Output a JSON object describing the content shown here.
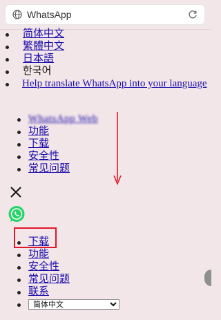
{
  "browser": {
    "url_text": "WhatsApp"
  },
  "languages": [
    {
      "label": "简体中文"
    },
    {
      "label": "繁體中文"
    },
    {
      "label": "日本語"
    },
    {
      "label": "한국어"
    },
    {
      "label": "Help translate WhatsApp into your language"
    }
  ],
  "nav_primary": {
    "items": [
      {
        "label": "WhatsApp Web"
      },
      {
        "label": "功能"
      },
      {
        "label": "下载"
      },
      {
        "label": "安全性"
      },
      {
        "label": "常见问题"
      }
    ]
  },
  "nav_secondary": {
    "items": [
      {
        "label": "下载"
      },
      {
        "label": "功能"
      },
      {
        "label": "安全性"
      },
      {
        "label": "常见问题"
      },
      {
        "label": "联系"
      }
    ],
    "language_select_value": "简体中文"
  },
  "colors": {
    "link": "#1a0dab",
    "annotation_red": "#e0162b",
    "whatsapp_green": "#25d366",
    "page_bg": "#f3e6e8"
  },
  "icons": {
    "globe": "globe-icon",
    "reload": "reload-icon",
    "close": "close-icon",
    "logo": "whatsapp-logo-icon",
    "arrow": "down-arrow-annotation"
  }
}
